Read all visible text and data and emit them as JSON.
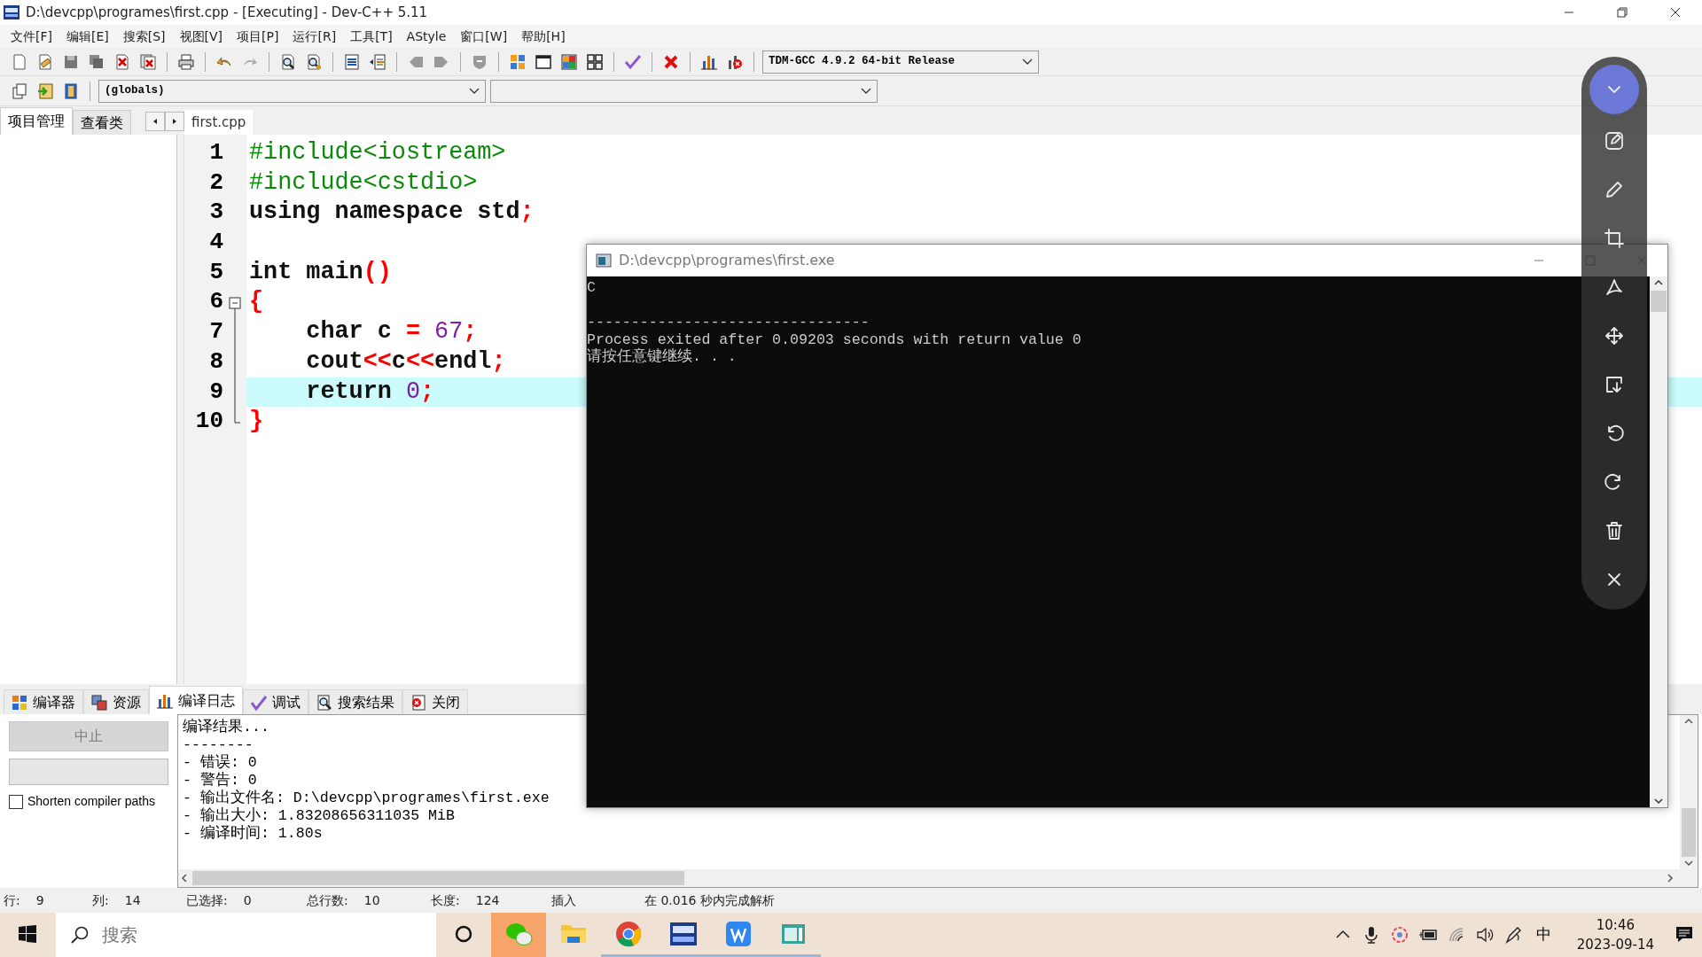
{
  "window": {
    "title": "D:\\devcpp\\programes\\first.cpp - [Executing] - Dev-C++ 5.11"
  },
  "menu": [
    "文件[F]",
    "编辑[E]",
    "搜索[S]",
    "视图[V]",
    "项目[P]",
    "运行[R]",
    "工具[T]",
    "AStyle",
    "窗口[W]",
    "帮助[H]"
  ],
  "compiler_select": {
    "value": "TDM-GCC 4.9.2 64-bit Release"
  },
  "scope_select": {
    "value": "(globals)"
  },
  "left_tabs": [
    {
      "label": "项目管理",
      "selected": true
    },
    {
      "label": "查看类",
      "selected": false
    }
  ],
  "editor_tabs": [
    {
      "label": "first.cpp",
      "selected": true
    }
  ],
  "code_lines": [
    {
      "number": "1",
      "current": false,
      "tokens": [
        {
          "kind": "preprocessor",
          "text": "#include<iostream>"
        }
      ]
    },
    {
      "number": "2",
      "current": false,
      "tokens": [
        {
          "kind": "preprocessor",
          "text": "#include<cstdio>"
        }
      ]
    },
    {
      "number": "3",
      "current": false,
      "tokens": [
        {
          "kind": "plain",
          "text": "using namespace std"
        },
        {
          "kind": "symbol",
          "text": ";"
        }
      ]
    },
    {
      "number": "4",
      "current": false
    },
    {
      "number": "5",
      "current": false,
      "tokens": [
        {
          "kind": "plain",
          "text": "int main"
        },
        {
          "kind": "symbol",
          "text": "()"
        }
      ]
    },
    {
      "number": "6",
      "current": false,
      "tokens": [
        {
          "kind": "symbol",
          "text": "{"
        }
      ],
      "children": [
        {
          "number": "7",
          "current": false,
          "tokens": [
            {
              "kind": "plain",
              "text": "    char c "
            },
            {
              "kind": "symbol",
              "text": "= "
            },
            {
              "kind": "number",
              "text": "67"
            },
            {
              "kind": "symbol",
              "text": ";"
            }
          ]
        },
        {
          "number": "8",
          "current": false,
          "tokens": [
            {
              "kind": "plain",
              "text": "    cout"
            },
            {
              "kind": "symbol",
              "text": "<<"
            },
            {
              "kind": "plain",
              "text": "c"
            },
            {
              "kind": "symbol",
              "text": "<<"
            },
            {
              "kind": "plain",
              "text": "endl"
            },
            {
              "kind": "symbol",
              "text": ";"
            }
          ]
        },
        {
          "number": "9",
          "current": true,
          "tokens": [
            {
              "kind": "plain",
              "text": "    return "
            },
            {
              "kind": "number",
              "text": "0"
            },
            {
              "kind": "symbol",
              "text": ";"
            }
          ]
        },
        {
          "number": "10",
          "current": false,
          "tokens": [
            {
              "kind": "symbol",
              "text": "}"
            }
          ]
        }
      ]
    }
  ],
  "bottom_tabs": [
    {
      "label": "编译器",
      "kind": "grid",
      "selected": false
    },
    {
      "label": "资源",
      "kind": "resources",
      "selected": false
    },
    {
      "label": "编译日志",
      "kind": "chart",
      "selected": true
    },
    {
      "label": "调试",
      "kind": "check",
      "selected": false
    },
    {
      "label": "搜索结果",
      "kind": "search",
      "selected": false
    },
    {
      "label": "关闭",
      "kind": "close",
      "selected": false
    }
  ],
  "abort_button": {
    "label": "中止",
    "disabled": true
  },
  "shorten_paths": {
    "label": "Shorten compiler paths",
    "checked": false
  },
  "compile_log": [
    "编译结果...",
    "--------",
    "- 错误: 0",
    "- 警告: 0",
    "- 输出文件名: D:\\devcpp\\programes\\first.exe",
    "- 输出大小: 1.83208656311035 MiB",
    "- 编译时间: 1.80s"
  ],
  "status_bar": [
    {
      "label": "行:",
      "value": "9"
    },
    {
      "label": "列:",
      "value": "14"
    },
    {
      "label": "已选择:",
      "value": "0"
    },
    {
      "label": "总行数:",
      "value": "10"
    },
    {
      "label": "长度:",
      "value": "124"
    },
    {
      "value": "插入"
    },
    {
      "value": "在 0.016 秒内完成解析"
    }
  ],
  "console": {
    "title": "D:\\devcpp\\programes\\first.exe",
    "output": "C\n\n--------------------------------\nProcess exited after 0.09203 seconds with return value 0\n请按任意键继续. . ."
  },
  "taskbar": {
    "search": {
      "placeholder": "搜索"
    },
    "apps": [
      {
        "kind": "chat",
        "flashing": true,
        "running": false
      },
      {
        "kind": "folder",
        "flashing": false,
        "running": false
      },
      {
        "kind": "browser",
        "flashing": false,
        "running": true
      },
      {
        "kind": "ide",
        "flashing": false,
        "running": true
      },
      {
        "kind": "writer",
        "flashing": false,
        "running": true
      },
      {
        "kind": "window",
        "flashing": false,
        "running": true
      }
    ],
    "ime": "中",
    "time": "10:46",
    "date": "2023-09-14"
  }
}
